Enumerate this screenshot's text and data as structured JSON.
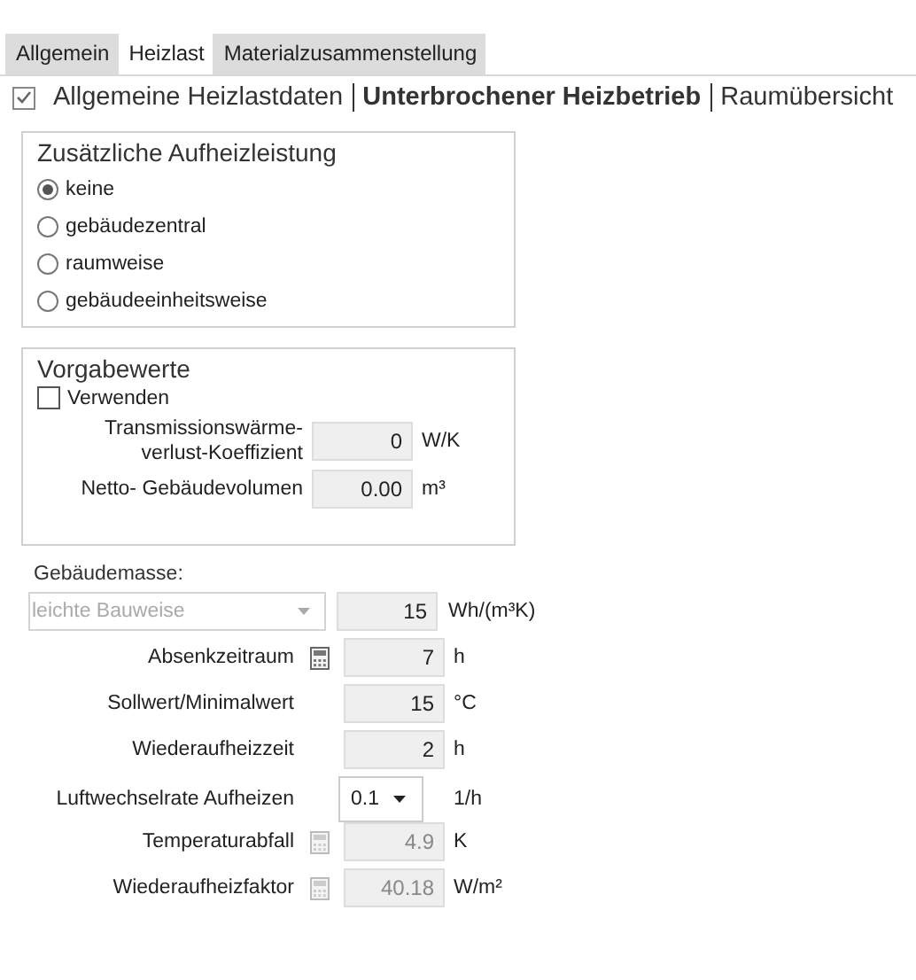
{
  "tabs": [
    {
      "label": "Allgemein",
      "selected": false
    },
    {
      "label": "Heizlast",
      "selected": true
    },
    {
      "label": "Materialzusammenstellung",
      "selected": false
    }
  ],
  "breadcrumb": {
    "checked": true,
    "items": [
      {
        "label": "Allgemeine Heizlastdaten",
        "selected": false
      },
      {
        "label": "Unterbrochener Heizbetrieb",
        "selected": true
      },
      {
        "label": "Raumübersicht",
        "selected": false
      }
    ]
  },
  "heating_power": {
    "title": "Zusätzliche Aufheizleistung",
    "options": [
      {
        "label": "keine",
        "selected": true
      },
      {
        "label": "gebäudezentral",
        "selected": false
      },
      {
        "label": "raumweise",
        "selected": false
      },
      {
        "label": "gebäudeeinheitsweise",
        "selected": false
      }
    ]
  },
  "defaults": {
    "title": "Vorgabewerte",
    "use": {
      "label": "Verwenden",
      "checked": false
    },
    "fields": [
      {
        "label": "Transmissionswärme-\nverlust-Koeffizient",
        "value": "0",
        "unit": "W/K"
      },
      {
        "label": "Netto- Gebäudevolumen",
        "value": "0.00",
        "unit": "m³"
      }
    ]
  },
  "building_mass": {
    "label": "Gebäudemasse:",
    "value": "leichte Bauweise",
    "disabled": true,
    "number": "15",
    "unit": "Wh/(m³K)"
  },
  "rows": [
    {
      "kind": "field",
      "label": "Absenkzeitraum",
      "calculator": true,
      "disabled": false,
      "value": "7",
      "unit": "h"
    },
    {
      "kind": "field",
      "label": "Sollwert/Minimalwert",
      "calculator": false,
      "disabled": false,
      "value": "15",
      "unit": "°C"
    },
    {
      "kind": "field",
      "label": "Wiederaufheizzeit",
      "calculator": false,
      "disabled": false,
      "value": "2",
      "unit": "h"
    },
    {
      "kind": "dropdown",
      "label": "Luftwechselrate Aufheizen",
      "calculator": false,
      "disabled": false,
      "value": "0.1",
      "unit": "1/h"
    },
    {
      "kind": "field",
      "label": "Temperaturabfall",
      "calculator": true,
      "disabled": true,
      "value": "4.9",
      "unit": "K"
    },
    {
      "kind": "field",
      "label": "Wiederaufheizfaktor",
      "calculator": true,
      "disabled": true,
      "value": "40.18",
      "unit": "W/m²"
    }
  ]
}
